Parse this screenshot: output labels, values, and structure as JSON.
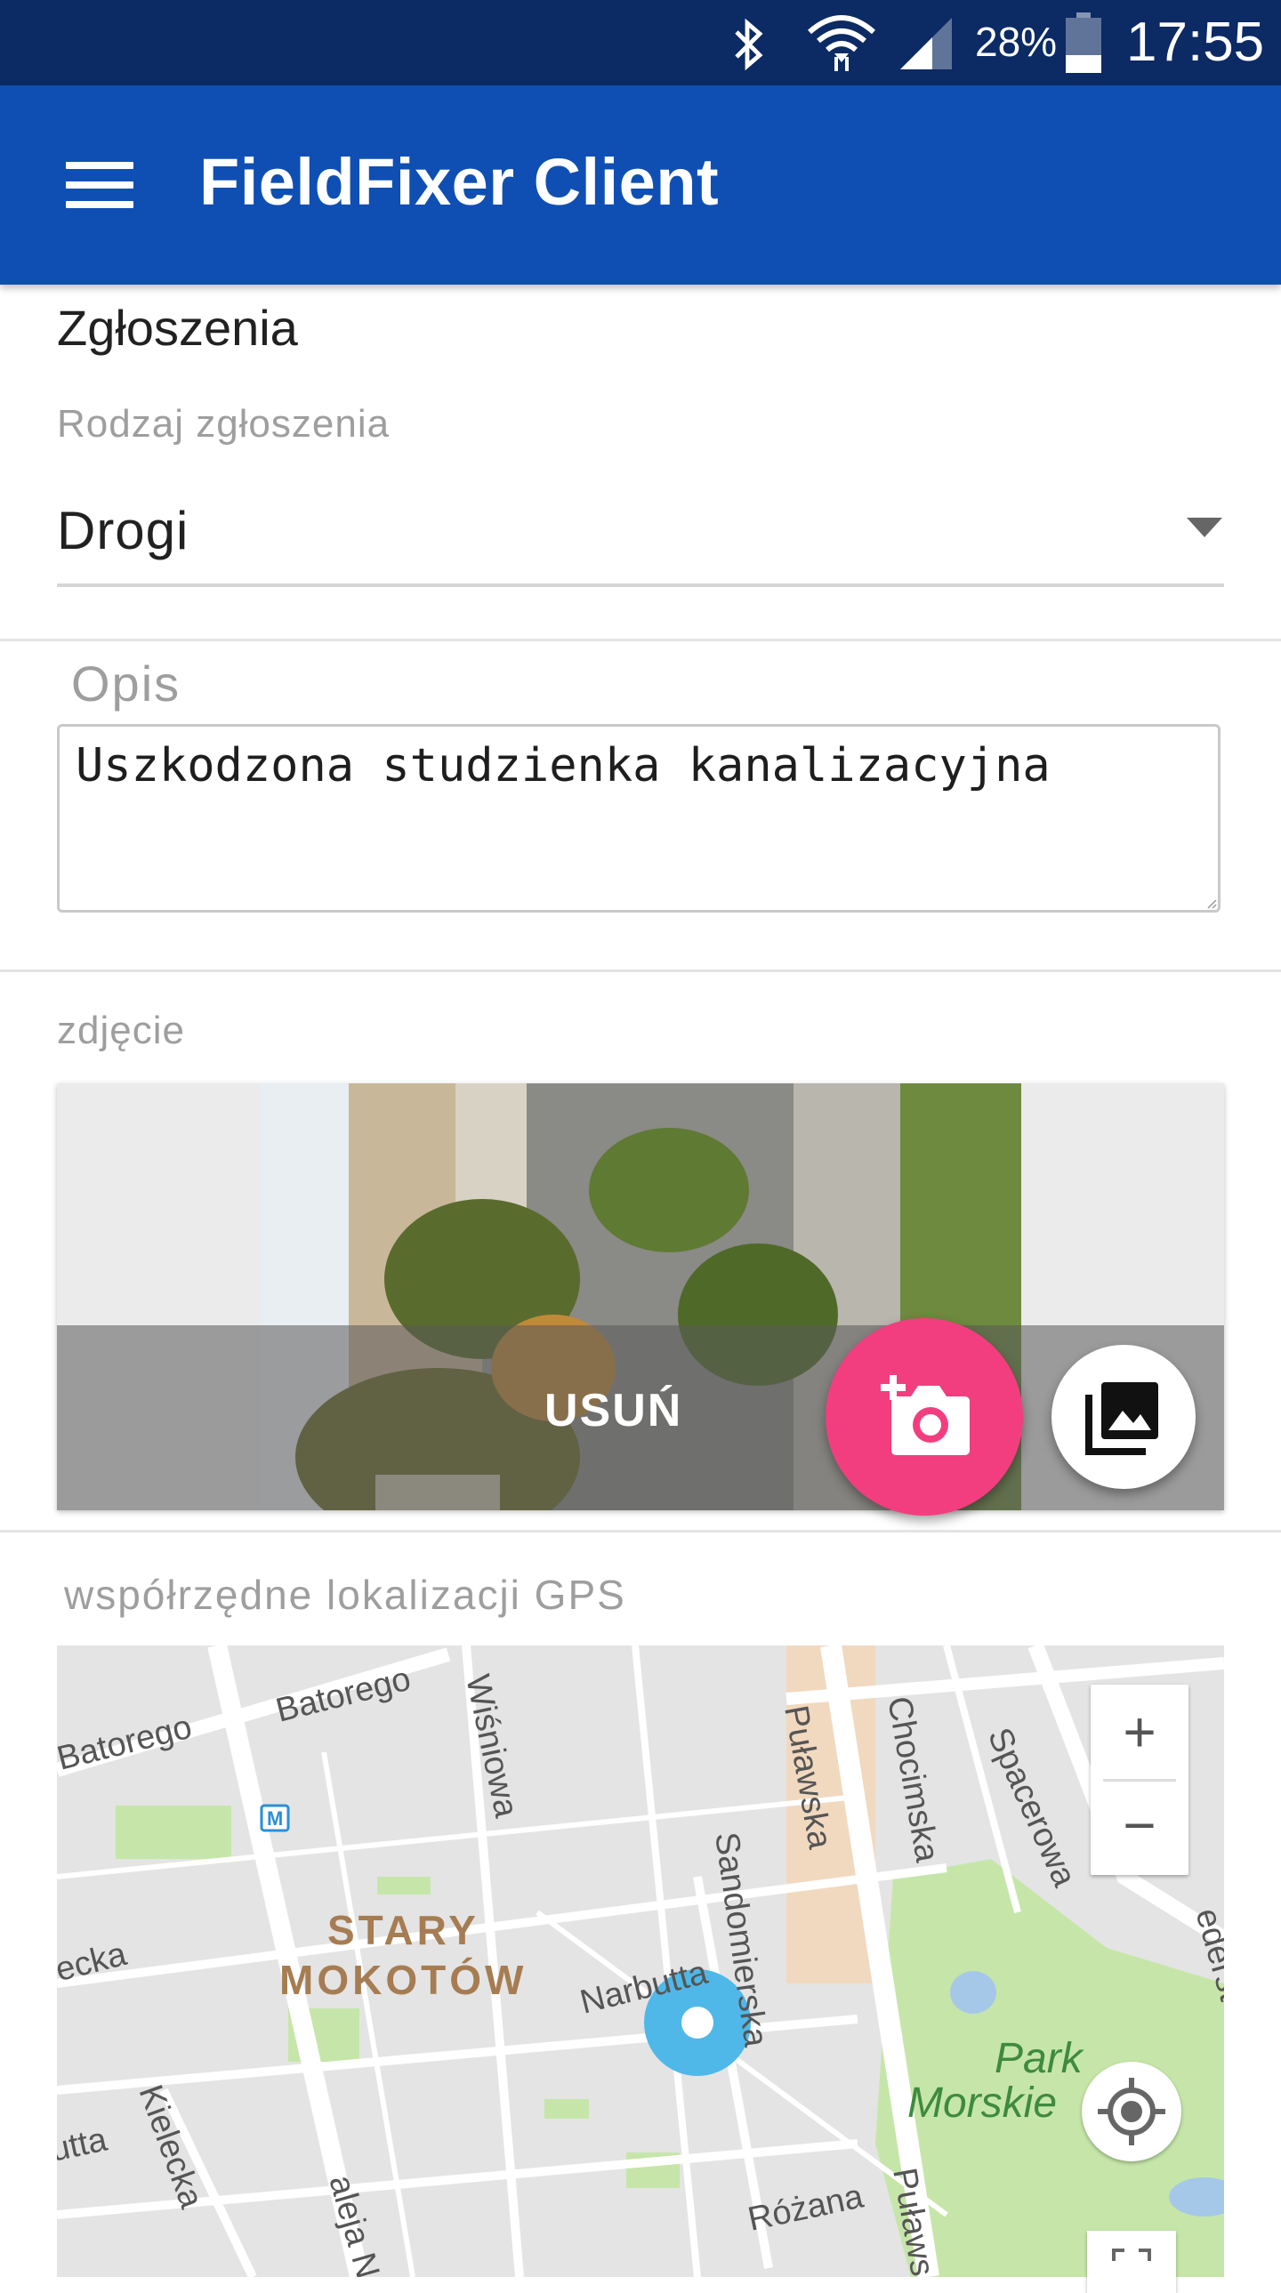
{
  "status_bar": {
    "battery_percent": "28%",
    "time": "17:55",
    "icons": [
      "bluetooth-icon",
      "wifi-icon",
      "signal-icon",
      "battery-icon"
    ]
  },
  "app_bar": {
    "title": "FieldFixer Client",
    "menu_icon": "hamburger-menu-icon"
  },
  "form": {
    "section_value": "Zgłoszenia",
    "type_label": "Rodzaj zgłoszenia",
    "type_value": "Drogi",
    "description_label": "Opis",
    "description_value": "Uszkodzona studzienka kanalizacyjna",
    "photo_label": "zdjęcie",
    "delete_label": "USUŃ",
    "gps_label": "współrzędne lokalizacji GPS"
  },
  "map": {
    "streets": [
      "Batorego",
      "Batorego",
      "Wiśniowa",
      "Puławska",
      "Chocimska",
      "Spacerowa",
      "Sandomierska",
      "Narbutta",
      "Kielecka",
      "aleja N",
      "Różana",
      "Puławs",
      "Iecka",
      "utta",
      "ederst"
    ],
    "district": [
      "STARY",
      "MOKOTÓW"
    ],
    "park": [
      "Park",
      "Morskie"
    ],
    "zoom_in": "+",
    "zoom_out": "−",
    "metro_badge": "M"
  },
  "colors": {
    "status_bar": "#0c2a63",
    "app_bar": "#0f4fb3",
    "camera_fab": "#f23e7f",
    "location_marker": "#4fb8e8"
  }
}
